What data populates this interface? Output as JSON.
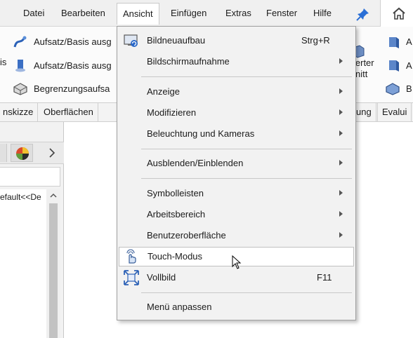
{
  "menubar": {
    "items": [
      "Datei",
      "Bearbeiten",
      "Ansicht",
      "Einfügen",
      "Extras",
      "Fenster",
      "Hilfe"
    ]
  },
  "ribbon": {
    "left_items": [
      "Aufsatz/Basis ausg",
      "Aufsatz/Basis ausg",
      "Begrenzungsaufsa"
    ],
    "left_edge_text": "is",
    "right_partial_1": "ierter",
    "right_partial_2": "nitt",
    "right_items": [
      "A",
      "A",
      "B"
    ]
  },
  "tabs": [
    "nskizze",
    "Oberflächen",
    "ung",
    "Evalui"
  ],
  "leftpanel": {
    "tree_text": "efault<<De"
  },
  "dropdown": {
    "items": [
      {
        "label": "Bildneuaufbau",
        "shortcut": "Strg+R",
        "submenu": false,
        "icon": "rebuild-icon"
      },
      {
        "label": "Bildschirmaufnahme",
        "shortcut": "",
        "submenu": true,
        "icon": ""
      },
      {
        "label": "Anzeige",
        "shortcut": "",
        "submenu": true,
        "icon": ""
      },
      {
        "label": "Modifizieren",
        "shortcut": "",
        "submenu": true,
        "icon": ""
      },
      {
        "label": "Beleuchtung und Kameras",
        "shortcut": "",
        "submenu": true,
        "icon": ""
      },
      {
        "label": "Ausblenden/Einblenden",
        "shortcut": "",
        "submenu": true,
        "icon": ""
      },
      {
        "label": "Symbolleisten",
        "shortcut": "",
        "submenu": true,
        "icon": ""
      },
      {
        "label": "Arbeitsbereich",
        "shortcut": "",
        "submenu": true,
        "icon": ""
      },
      {
        "label": "Benutzeroberfläche",
        "shortcut": "",
        "submenu": true,
        "icon": ""
      },
      {
        "label": "Touch-Modus",
        "shortcut": "",
        "submenu": false,
        "icon": "touch-hand-icon"
      },
      {
        "label": "Vollbild",
        "shortcut": "F11",
        "submenu": false,
        "icon": "fullscreen-icon"
      },
      {
        "label": "Menü anpassen",
        "shortcut": "",
        "submenu": false,
        "icon": ""
      }
    ]
  }
}
